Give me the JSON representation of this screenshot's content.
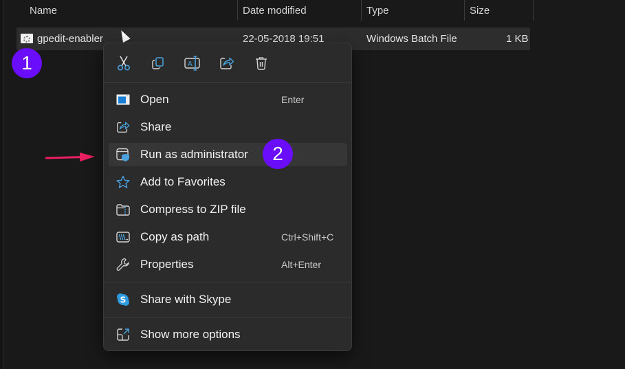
{
  "explorer": {
    "columns": [
      {
        "label": "Name"
      },
      {
        "label": "Date modified"
      },
      {
        "label": "Type"
      },
      {
        "label": "Size"
      }
    ],
    "file": {
      "name": "gpedit-enabler",
      "date_modified": "22-05-2018 19:51",
      "type": "Windows Batch File",
      "size": "1 KB",
      "icon": "batch-file-icon"
    }
  },
  "annotations": {
    "step1": "1",
    "step2": "2",
    "badge_color": "#6a0dfa",
    "arrow_color": "#ec1e62"
  },
  "context_menu": {
    "toolbar": [
      {
        "name": "cut",
        "icon": "scissors-icon"
      },
      {
        "name": "copy",
        "icon": "copy-icon"
      },
      {
        "name": "rename",
        "icon": "rename-icon"
      },
      {
        "name": "share",
        "icon": "share-icon"
      },
      {
        "name": "delete",
        "icon": "trash-icon"
      }
    ],
    "items": [
      {
        "label": "Open",
        "shortcut": "Enter",
        "icon": "open-window-icon"
      },
      {
        "label": "Share",
        "shortcut": "",
        "icon": "share-icon"
      },
      {
        "label": "Run as administrator",
        "shortcut": "",
        "icon": "shield-window-icon",
        "highlighted": true
      },
      {
        "label": "Add to Favorites",
        "shortcut": "",
        "icon": "star-icon"
      },
      {
        "label": "Compress to ZIP file",
        "shortcut": "",
        "icon": "zip-folder-icon"
      },
      {
        "label": "Copy as path",
        "shortcut": "Ctrl+Shift+C",
        "icon": "copy-path-icon"
      },
      {
        "label": "Properties",
        "shortcut": "Alt+Enter",
        "icon": "wrench-icon"
      },
      {
        "label": "Share with Skype",
        "shortcut": "",
        "icon": "skype-icon"
      },
      {
        "label": "Show more options",
        "shortcut": "",
        "icon": "expand-icon"
      }
    ],
    "accent": "#4aa3df"
  }
}
